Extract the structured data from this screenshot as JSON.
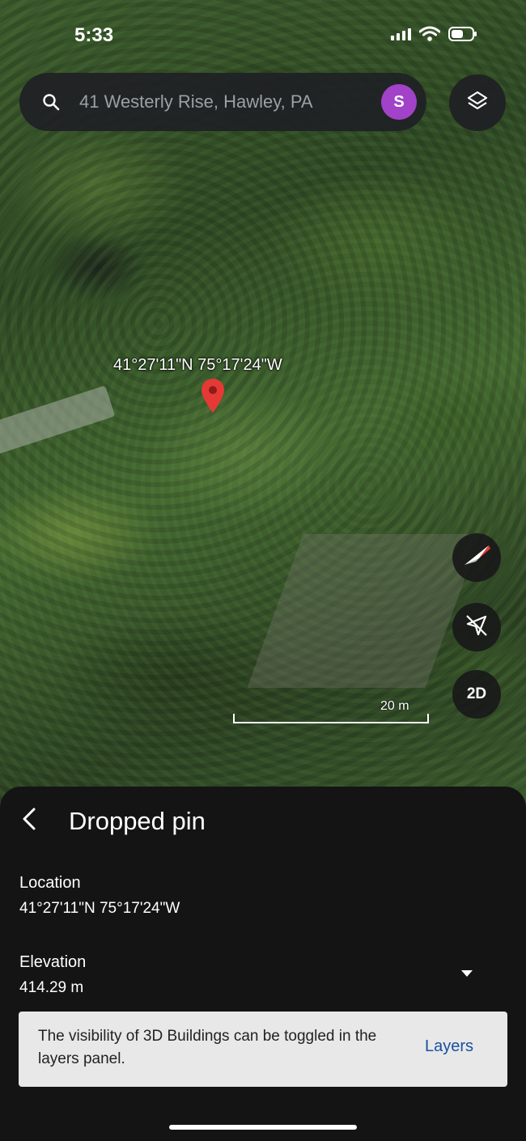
{
  "status_bar": {
    "time": "5:33"
  },
  "search": {
    "query": "41 Westerly Rise, Hawley, PA",
    "avatar_letter": "S"
  },
  "map": {
    "pin_label": "41°27'11\"N 75°17'24\"W",
    "scale_label": "20 m",
    "view_toggle_label": "2D"
  },
  "panel": {
    "title": "Dropped pin",
    "location_label": "Location",
    "location_value": "41°27'11\"N 75°17'24\"W",
    "elevation_label": "Elevation",
    "elevation_value": "414.29 m"
  },
  "snackbar": {
    "message": "The visibility of 3D Buildings can be toggled in the layers panel.",
    "action": "Layers"
  },
  "colors": {
    "avatar": "#a142c8",
    "pin": "#e53935",
    "link": "#1a4fa0"
  },
  "icons": [
    "search-icon",
    "layers-icon",
    "compass-icon",
    "location-off-icon",
    "back-arrow-icon",
    "dropdown-icon"
  ]
}
